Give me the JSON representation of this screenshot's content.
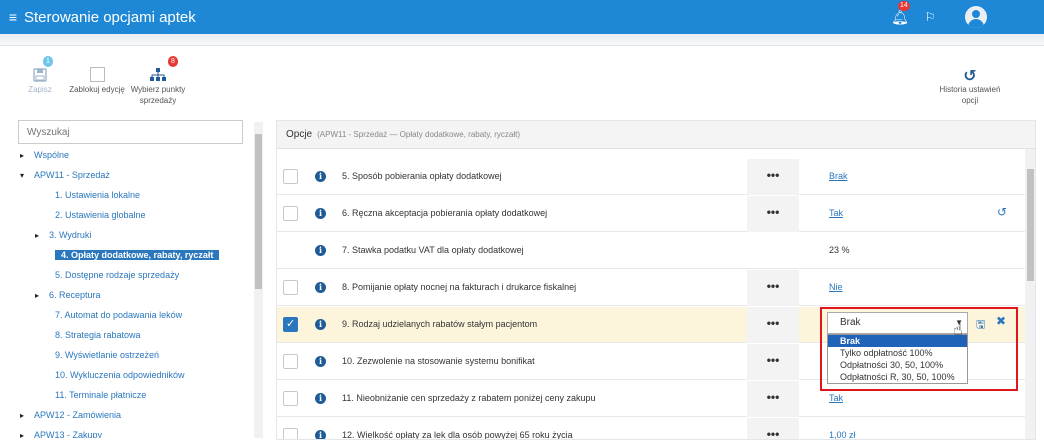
{
  "app": {
    "title": "Sterowanie opcjami aptek",
    "notifications_count": "14"
  },
  "toolbar": {
    "save": {
      "label": "Zapisz",
      "badge": "1"
    },
    "lock": {
      "label": "Zablokuj edycję"
    },
    "points": {
      "label": "Wybierz punkty sprzedaży",
      "badge": "8"
    },
    "history": {
      "label": "Historia ustawień opcji"
    }
  },
  "search": {
    "placeholder": "Wyszukaj"
  },
  "tree": [
    {
      "label": "Wspólne",
      "level": 0,
      "arrow": "▸"
    },
    {
      "label": "APW11 - Sprzedaż",
      "level": 0,
      "arrow": "▾"
    },
    {
      "label": "1. Ustawienia lokalne",
      "level": 1,
      "arrow": ""
    },
    {
      "label": "2. Ustawienia globalne",
      "level": 1,
      "arrow": ""
    },
    {
      "label": "3. Wydruki",
      "level": 1,
      "arrow": "▸"
    },
    {
      "label": "4. Opłaty dodatkowe, rabaty, ryczałt",
      "level": 1,
      "arrow": "",
      "active": true
    },
    {
      "label": "5. Dostępne rodzaje sprzedaży",
      "level": 1,
      "arrow": ""
    },
    {
      "label": "6. Receptura",
      "level": 1,
      "arrow": "▸"
    },
    {
      "label": "7. Automat do podawania leków",
      "level": 1,
      "arrow": ""
    },
    {
      "label": "8. Strategia rabatowa",
      "level": 1,
      "arrow": ""
    },
    {
      "label": "9. Wyświetlanie ostrzeżeń",
      "level": 1,
      "arrow": ""
    },
    {
      "label": "10. Wykluczenia odpowiedników",
      "level": 1,
      "arrow": ""
    },
    {
      "label": "11. Terminale płatnicze",
      "level": 1,
      "arrow": ""
    },
    {
      "label": "APW12 - Zamówienia",
      "level": 0,
      "arrow": "▸"
    },
    {
      "label": "APW13 - Zakupy",
      "level": 0,
      "arrow": "▸"
    }
  ],
  "options_panel": {
    "header": "Opcje",
    "breadcrumb": "(APW11 - Sprzedaż — Opłaty dodatkowe, rabaty, ryczałt)",
    "rows": [
      {
        "label": "5. Sposób pobierania opłaty dodatkowej",
        "value": "Brak",
        "link": true,
        "checkbox": true,
        "dots": true
      },
      {
        "label": "6. Ręczna akceptacja pobierania opłaty dodatkowej",
        "value": "Tak",
        "link": true,
        "checkbox": true,
        "dots": true,
        "undo": true
      },
      {
        "label": "7. Stawka podatku VAT dla opłaty dodatkowej",
        "value": "23 %",
        "link": false,
        "checkbox": false,
        "dots": false
      },
      {
        "label": "8. Pomijanie opłaty nocnej na fakturach i drukarce fiskalnej",
        "value": "Nie",
        "link": true,
        "checkbox": true,
        "dots": true
      },
      {
        "label": "9. Rodzaj udzielanych rabatów stałym pacjentom",
        "value": "",
        "link": false,
        "checkbox": true,
        "checked": true,
        "dots": true,
        "selected": true
      },
      {
        "label": "10. Zezwolenie na stosowanie systemu bonifikat",
        "value": "",
        "link": true,
        "checkbox": true,
        "dots": true
      },
      {
        "label": "11. Nieobniżanie cen sprzedaży z rabatem poniżej ceny zakupu",
        "value": "Tak",
        "link": true,
        "checkbox": true,
        "dots": true
      },
      {
        "label": "12. Wielkość opłaty za lek dla osób powyżej 65 roku życia",
        "value": "1,00 zł",
        "link": true,
        "checkbox": true,
        "dots": true
      }
    ]
  },
  "dropdown": {
    "selected": "Brak",
    "options": [
      "Brak",
      "Tylko odpłatność 100%",
      "Odpłatności 30, 50, 100%",
      "Odpłatności R, 30, 50, 100%"
    ],
    "highlighted": 0
  }
}
